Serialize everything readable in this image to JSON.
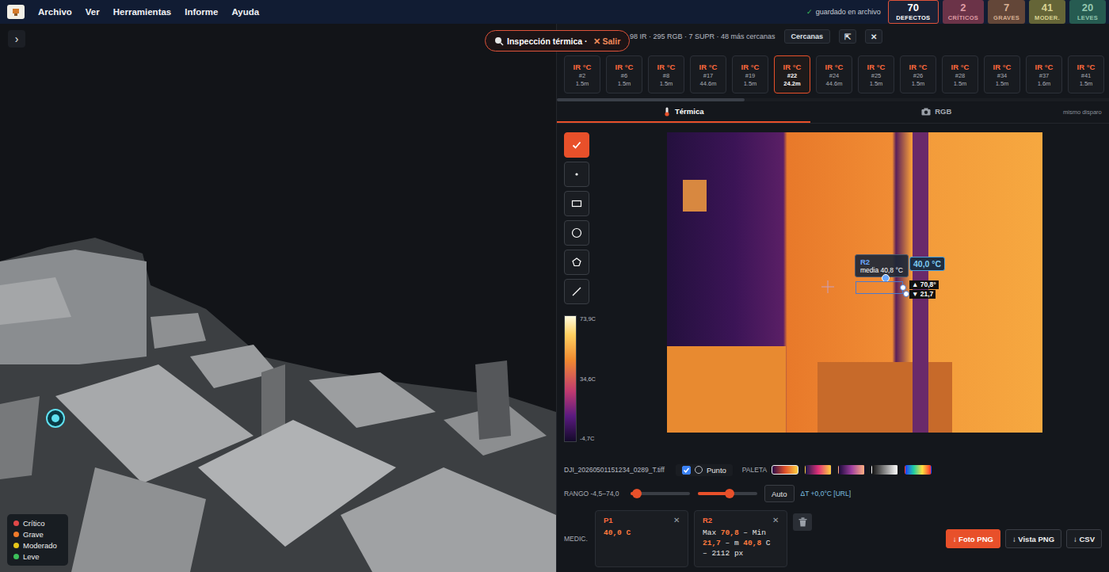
{
  "menu": [
    "Archivo",
    "Ver",
    "Herramientas",
    "Informe",
    "Ayuda"
  ],
  "save_status": {
    "icon": "✓",
    "text": "guardado en archivo"
  },
  "counters": [
    {
      "value": "70",
      "label": "DEFECTOS",
      "color": "#e0533a",
      "selected": true
    },
    {
      "value": "2",
      "label": "CRÍTICOS",
      "color": "#c44a5c",
      "selected": false
    },
    {
      "value": "7",
      "label": "GRAVES",
      "color": "#b5703c",
      "selected": false
    },
    {
      "value": "41",
      "label": "MODER.",
      "color": "#b8ad3a",
      "selected": false
    },
    {
      "value": "20",
      "label": "LEVES",
      "color": "#3a9a6e",
      "selected": false
    }
  ],
  "viewer": {
    "toggle": "›",
    "mode_pill": {
      "title": "Inspección térmica ·",
      "exit": "✕ Salir"
    },
    "legend": [
      {
        "label": "Crítico",
        "color": "#e04848"
      },
      {
        "label": "Grave",
        "color": "#f07b2a"
      },
      {
        "label": "Moderado",
        "color": "#e6c619"
      },
      {
        "label": "Leve",
        "color": "#3cbf5a"
      }
    ]
  },
  "panel": {
    "summary": "98 IR · 295 RGB · 7 SUPR · 48 más cercanas",
    "nearby_button": "Cercanas",
    "expand": "⇱",
    "close": "✕"
  },
  "thumbnails": [
    {
      "label": "IR °C",
      "id": "#2",
      "distance": "1.5m",
      "selected": false
    },
    {
      "label": "IR °C",
      "id": "#6",
      "distance": "1.5m",
      "selected": false
    },
    {
      "label": "IR °C",
      "id": "#8",
      "distance": "1.5m",
      "selected": false
    },
    {
      "label": "IR °C",
      "id": "#17",
      "distance": "44.6m",
      "selected": false
    },
    {
      "label": "IR °C",
      "id": "#19",
      "distance": "1.5m",
      "selected": false
    },
    {
      "label": "IR °C",
      "id": "#22",
      "distance": "24.2m",
      "selected": true
    },
    {
      "label": "IR °C",
      "id": "#24",
      "distance": "44.6m",
      "selected": false
    },
    {
      "label": "IR °C",
      "id": "#25",
      "distance": "1.5m",
      "selected": false
    },
    {
      "label": "IR °C",
      "id": "#26",
      "distance": "1.5m",
      "selected": false
    },
    {
      "label": "IR °C",
      "id": "#28",
      "distance": "1.5m",
      "selected": false
    },
    {
      "label": "IR °C",
      "id": "#34",
      "distance": "1.5m",
      "selected": false
    },
    {
      "label": "IR °C",
      "id": "#37",
      "distance": "1.6m",
      "selected": false
    },
    {
      "label": "IR °C",
      "id": "#41",
      "distance": "1.5m",
      "selected": false
    }
  ],
  "thumb_scroll": {
    "level": 0.34
  },
  "tabs": [
    {
      "label": "Térmica",
      "kind": "thermal",
      "selected": true
    },
    {
      "label": "RGB",
      "kind": "camera",
      "selected": false
    }
  ],
  "tabs_note": "mismo disparo",
  "tools": [
    {
      "kind": "check",
      "selected": true
    },
    {
      "kind": "point",
      "selected": false
    },
    {
      "kind": "rect",
      "selected": false
    },
    {
      "kind": "circle",
      "selected": false
    },
    {
      "kind": "polygon",
      "selected": false
    },
    {
      "kind": "line",
      "selected": false
    }
  ],
  "colorbar": {
    "max": "73,9C",
    "mid": "34,6C",
    "min": "-4,7C"
  },
  "image_overlay": {
    "region": {
      "name": "R2",
      "mean": "media 40,8 °C",
      "max": "▲ 70,8°",
      "min": "▼ 21,7"
    },
    "point": {
      "value": "40,0 °C"
    }
  },
  "file": "DJI_20260501151234_0289_T.tiff",
  "point_toggle": {
    "checked": true,
    "label": "Punto",
    "selected": false
  },
  "palette": {
    "label": "PALETA",
    "options": [
      {
        "selected": true,
        "colors": [
          "#2a0a4a",
          "#e0502a",
          "#ffd040"
        ]
      },
      {
        "selected": false,
        "colors": [
          "#1a1a4a",
          "#e0307a",
          "#ffd040"
        ]
      },
      {
        "selected": false,
        "colors": [
          "#1a0a3a",
          "#a040a0",
          "#ffb080"
        ]
      },
      {
        "selected": false,
        "colors": [
          "#111111",
          "#888888",
          "#ffffff"
        ]
      },
      {
        "selected": false,
        "colors": [
          "#2040ff",
          "#20d0a0",
          "#ffe040",
          "#ff3030"
        ]
      }
    ]
  },
  "range": {
    "label": "RANGO -4,5–74,0",
    "sliders": [
      {
        "level": 0.1
      },
      {
        "level": 0.53
      }
    ],
    "auto_button": "Auto",
    "delta": "ΔT +0,0°C [URL]"
  },
  "measurements": {
    "label": "MEDIC.",
    "items": [
      {
        "name": "P1",
        "close": "✕",
        "parts": [
          {
            "text": "40,0 C",
            "highlight": true
          }
        ]
      },
      {
        "name": "R2",
        "close": "✕",
        "parts": [
          {
            "text": "Max ",
            "highlight": false
          },
          {
            "text": "70,8",
            "highlight": true
          },
          {
            "text": " – Min ",
            "highlight": false
          },
          {
            "text": "21,7",
            "highlight": true
          },
          {
            "text": " – m ",
            "highlight": false
          },
          {
            "text": "40,8",
            "highlight": true
          },
          {
            "text": " C – 2112 px",
            "highlight": false
          }
        ]
      }
    ]
  },
  "exports": [
    {
      "label": "↓ Foto PNG",
      "primary": true
    },
    {
      "label": "↓ Vista PNG",
      "primary": false
    },
    {
      "label": "↓ CSV",
      "primary": false
    }
  ]
}
